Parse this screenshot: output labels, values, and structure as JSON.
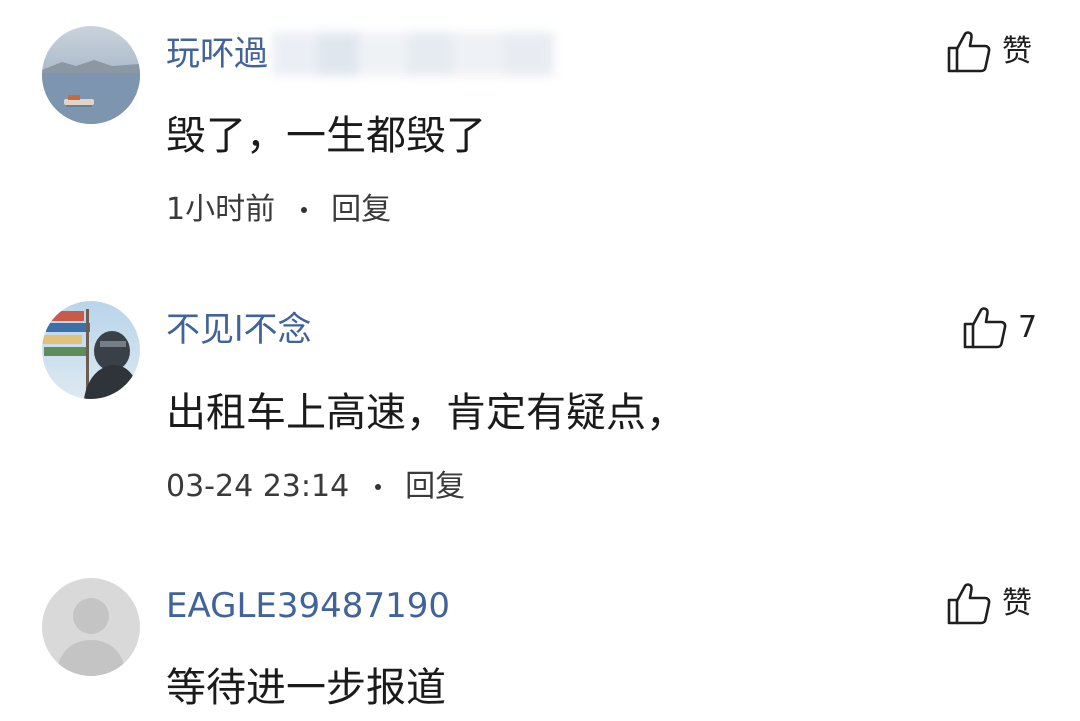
{
  "comments": [
    {
      "avatar": "lake-landscape-avatar",
      "username": "玩吥過",
      "username_redacted": true,
      "content": "毁了，一生都毁了",
      "time": "1小时前",
      "reply_label": "回复",
      "like_icon": "thumbs-up-icon",
      "like_label": "赞"
    },
    {
      "avatar": "street-signs-photo-avatar",
      "username": "不见l不念",
      "content": "出租车上高速，肯定有疑点，",
      "time": "03-24 23:14",
      "reply_label": "回复",
      "like_icon": "thumbs-up-icon",
      "like_label": "7"
    },
    {
      "avatar": "default-gray-avatar",
      "username": "EAGLE39487190",
      "content": "等待进一步报道",
      "like_icon": "thumbs-up-icon",
      "like_label": "赞"
    }
  ],
  "colors": {
    "username": "#40639a",
    "content": "#1b1b1b",
    "meta": "#3a3a3a",
    "background": "#ffffff"
  }
}
